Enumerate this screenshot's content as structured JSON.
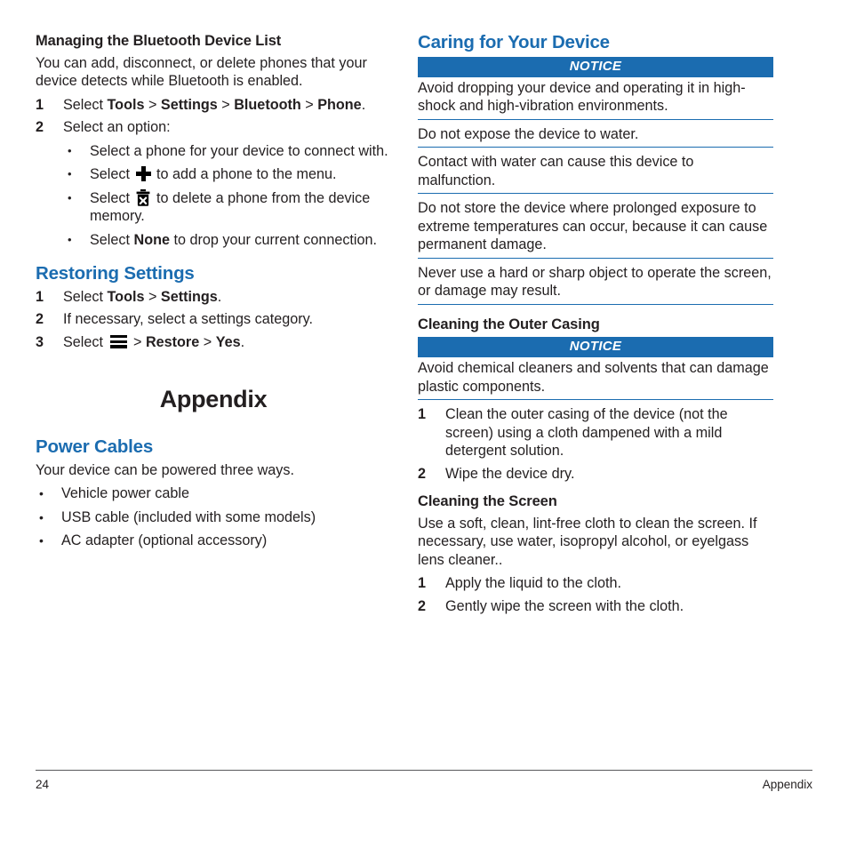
{
  "page": {
    "number": "24",
    "running_head": "Appendix",
    "chapter_title": "Appendix"
  },
  "colors": {
    "heading_blue": "#1b6cb0",
    "notice_blue": "#1b6cb0",
    "body_text": "#231f20",
    "rule_blue": "#1b6cb0"
  },
  "left_column": {
    "bluetooth_section": {
      "heading": "Managing the Bluetooth Device List",
      "intro": "You can add, disconnect, or delete phones that your device detects while Bluetooth is enabled.",
      "step1": {
        "number": "1",
        "prefix": "Select ",
        "tools": "Tools",
        "sep1": " > ",
        "settings": "Settings",
        "sep2": " > ",
        "bluetooth": "Bluetooth",
        "sep3": " > ",
        "phone": "Phone",
        "suffix": "."
      },
      "step2": {
        "number": "2",
        "text": "Select an option:",
        "options": [
          {
            "text": "Select a phone for your device to connect with."
          },
          {
            "prefix": "Select ",
            "icon": "plus-icon",
            "suffix": " to add a phone to the menu."
          },
          {
            "prefix": "Select ",
            "icon": "trash-delete-icon",
            "suffix": " to delete a phone from the device memory."
          },
          {
            "prefix": "Select ",
            "bold": "None",
            "suffix": " to drop your current connection."
          }
        ]
      }
    },
    "restoring_section": {
      "heading": "Restoring Settings",
      "steps": [
        {
          "number": "1",
          "prefix": "Select ",
          "tools": "Tools",
          "sep": " > ",
          "settings": "Settings",
          "suffix": "."
        },
        {
          "number": "2",
          "text": "If necessary, select a settings category."
        },
        {
          "number": "3",
          "prefix": "Select ",
          "icon": "hamburger-menu-icon",
          "sep1": " > ",
          "restore": "Restore",
          "sep2": " > ",
          "yes": "Yes",
          "suffix": "."
        }
      ]
    },
    "power_cables_section": {
      "heading": "Power Cables",
      "intro": "Your device can be powered three ways.",
      "bullets": [
        "Vehicle power cable",
        "USB cable (included with some models)",
        "AC adapter (optional accessory)"
      ]
    }
  },
  "right_column": {
    "caring_section": {
      "heading": "Caring for Your Device",
      "notice_label": "NOTICE",
      "notices": [
        "Avoid dropping your device and operating it in high-shock and high-vibration environments.",
        "Do not expose the device to water.",
        "Contact with water can cause this device to malfunction.",
        "Do not store the device where prolonged exposure to extreme temperatures can occur, because it can cause permanent damage.",
        "Never use a hard or sharp object to operate the screen, or damage may result."
      ]
    },
    "outer_casing_section": {
      "heading": "Cleaning the Outer Casing",
      "notice_label": "NOTICE",
      "notice_text": "Avoid chemical cleaners and solvents that can damage plastic components.",
      "steps": [
        {
          "number": "1",
          "text": "Clean the outer casing of the device (not the screen) using a cloth dampened with a mild detergent solution."
        },
        {
          "number": "2",
          "text": "Wipe the device dry."
        }
      ]
    },
    "screen_section": {
      "heading": "Cleaning the Screen",
      "intro": "Use a soft, clean, lint-free cloth to clean the screen. If necessary, use water, isopropyl alcohol, or eyelgass lens cleaner..",
      "steps": [
        {
          "number": "1",
          "text": "Apply the liquid to the cloth."
        },
        {
          "number": "2",
          "text": "Gently wipe the screen with the cloth."
        }
      ]
    }
  }
}
